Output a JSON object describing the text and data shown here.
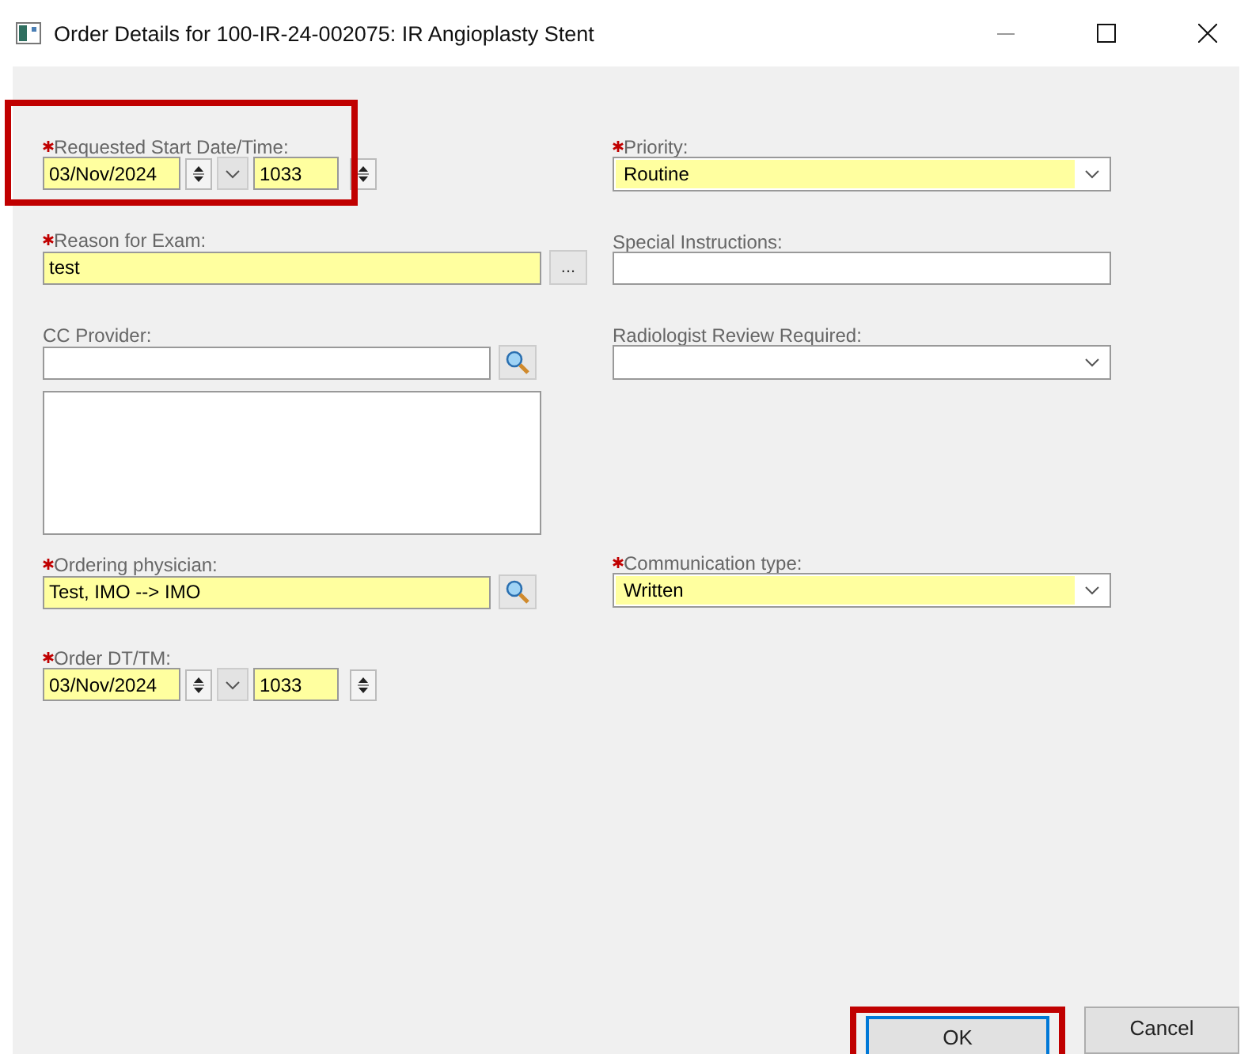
{
  "window": {
    "title": "Order Details for 100-IR-24-002075: IR Angioplasty Stent"
  },
  "left": [
    {
      "kind": "datetime",
      "label": "Requested Start Date/Time:",
      "required": true,
      "highlighted": true,
      "date": "03/Nov/2024",
      "time": "1033"
    },
    {
      "kind": "text_button",
      "label": "Reason for Exam:",
      "required": true,
      "value": "test",
      "button_label": "..."
    },
    {
      "kind": "lookup_list",
      "label": "CC Provider:",
      "required": false
    },
    {
      "kind": "lookup",
      "label": "Ordering physician:",
      "required": true,
      "value": "Test, IMO --> IMO"
    },
    {
      "kind": "datetime",
      "label": "Order DT/TM:",
      "required": true,
      "date": "03/Nov/2024",
      "time": "1033"
    }
  ],
  "right": [
    {
      "kind": "select",
      "label": "Priority:",
      "required": true,
      "value": "Routine"
    },
    {
      "kind": "text",
      "label": "Special Instructions:",
      "required": false
    },
    {
      "kind": "select",
      "label": "Radiologist Review Required:",
      "required": false
    },
    {
      "kind": "select",
      "label": "Communication type:",
      "required": true,
      "value": "Written"
    }
  ],
  "buttons": [
    {
      "label": "OK",
      "default": true,
      "highlighted": true
    },
    {
      "label": "Cancel",
      "default": false
    }
  ]
}
